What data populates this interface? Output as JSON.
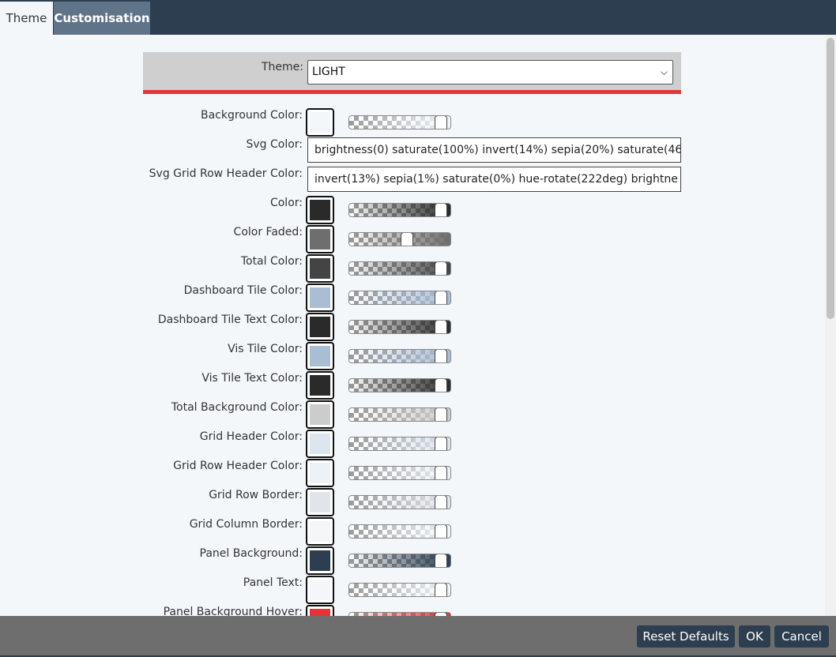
{
  "tabs": [
    {
      "label": "Theme",
      "active": true
    },
    {
      "label": "Customisation",
      "active": false
    }
  ],
  "theme": {
    "label": "Theme:",
    "value": "LIGHT"
  },
  "rows": [
    {
      "label": "Background Color:",
      "kind": "color",
      "color": "#f3f7fa",
      "alpha": 1.0
    },
    {
      "label": "Svg Color:",
      "kind": "text",
      "value": "brightness(0) saturate(100%) invert(14%) sepia(20%) saturate(46"
    },
    {
      "label": "Svg Grid Row Header Color:",
      "kind": "text",
      "value": "invert(13%) sepia(1%) saturate(0%) hue-rotate(222deg) brightne"
    },
    {
      "label": "Color:",
      "kind": "color",
      "color": "#2a2a2a",
      "alpha": 1.0
    },
    {
      "label": "Color Faded:",
      "kind": "color",
      "color": "#6e6e6e",
      "alpha": 0.6
    },
    {
      "label": "Total Color:",
      "kind": "color",
      "color": "#444444",
      "alpha": 1.0
    },
    {
      "label": "Dashboard Tile Color:",
      "kind": "color",
      "color": "#a9bdd3",
      "alpha": 1.0
    },
    {
      "label": "Dashboard Tile Text Color:",
      "kind": "color",
      "color": "#2a2a2a",
      "alpha": 1.0
    },
    {
      "label": "Vis Tile Color:",
      "kind": "color",
      "color": "#a9bdd3",
      "alpha": 1.0
    },
    {
      "label": "Vis Tile Text Color:",
      "kind": "color",
      "color": "#2a2a2a",
      "alpha": 1.0
    },
    {
      "label": "Total Background Color:",
      "kind": "color",
      "color": "#cccccc",
      "alpha": 1.0
    },
    {
      "label": "Grid Header Color:",
      "kind": "color",
      "color": "#dde6ef",
      "alpha": 1.0
    },
    {
      "label": "Grid Row Header Color:",
      "kind": "color",
      "color": "#edf2f7",
      "alpha": 1.0
    },
    {
      "label": "Grid Row Border:",
      "kind": "color",
      "color": "#e1e5ea",
      "alpha": 1.0
    },
    {
      "label": "Grid Column Border:",
      "kind": "color",
      "color": "#f3f7fa",
      "alpha": 1.0
    },
    {
      "label": "Panel Background:",
      "kind": "color",
      "color": "#2c3e50",
      "alpha": 1.0
    },
    {
      "label": "Panel Text:",
      "kind": "color",
      "color": "#f3f7fa",
      "alpha": 1.0
    },
    {
      "label": "Panel Background Hover:",
      "kind": "color",
      "color": "#e3343a",
      "alpha": 1.0
    }
  ],
  "footer": {
    "reset_label": "Reset Defaults",
    "ok_label": "OK",
    "cancel_label": "Cancel"
  }
}
